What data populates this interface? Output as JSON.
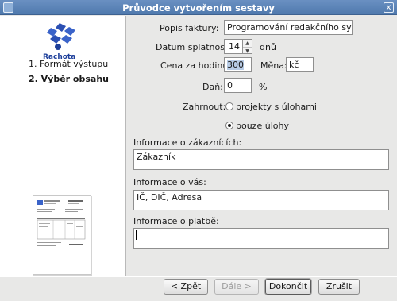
{
  "window": {
    "title": "Průvodce vytvořením sestavy",
    "close_glyph": "x",
    "icon": "app-icon"
  },
  "sidebar": {
    "logo_icon": "rachota-logo-icon",
    "logo_text": "Rachota",
    "steps": [
      {
        "label": "1. Formát výstupu"
      },
      {
        "label": "2. Výběr obsahu"
      }
    ],
    "preview_icon": "report-preview-thumbnail"
  },
  "form": {
    "invoice_label": "Popis faktury:",
    "invoice_value": "Programování redakčního systému",
    "due_label": "Datum splatnosti:",
    "due_value": "14",
    "due_unit": "dnů",
    "rate_label": "Cena za hodinu:",
    "rate_value": "300",
    "currency_label": "Měna:",
    "currency_value": "kč",
    "tax_label": "Daň:",
    "tax_value": "0",
    "tax_unit": "%",
    "include_label": "Zahrnout:",
    "include_options": [
      {
        "label": "projekty s úlohami",
        "checked": false
      },
      {
        "label": "pouze úlohy",
        "checked": true
      }
    ],
    "customer_label": "Informace o zákaznících:",
    "customer_value": "Zákazník",
    "you_label": "Informace o vás:",
    "you_value": "IČ, DIČ, Adresa",
    "payment_label": "Informace o platbě:",
    "payment_value": ""
  },
  "buttons": {
    "back": "< Zpět",
    "next": "Dále >",
    "finish": "Dokončit",
    "cancel": "Zrušit"
  },
  "colors": {
    "titlebar": "#5a83b8",
    "selection": "#b8cce6",
    "logo_blue": "#1c3e9a",
    "background": "#e8e8e7"
  }
}
